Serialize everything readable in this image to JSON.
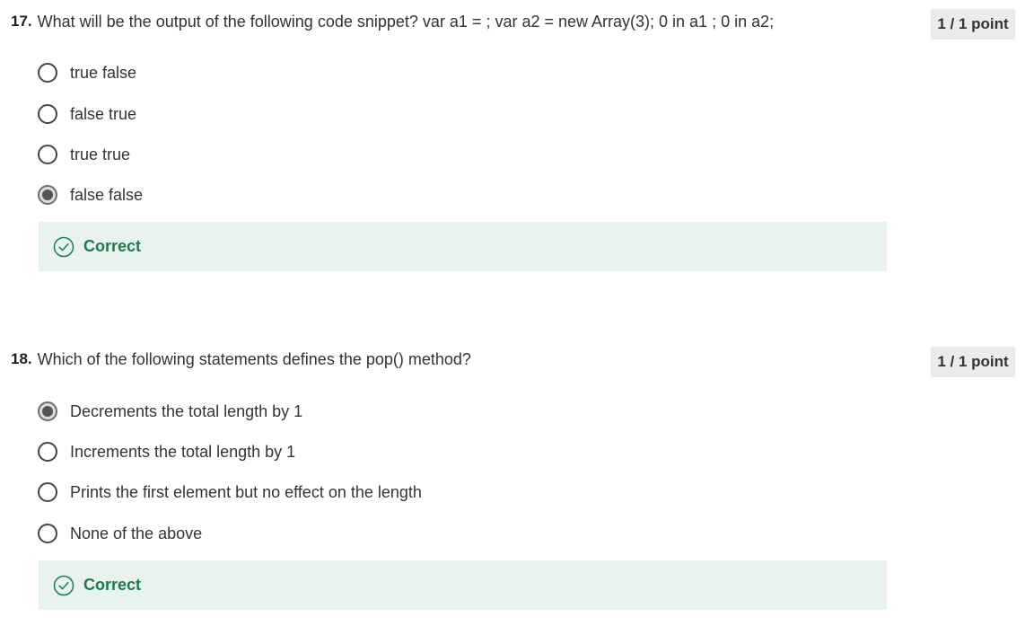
{
  "colors": {
    "correct_bg": "#e8f2ee",
    "correct_text": "#1e7a4f",
    "points_bg": "#ebebeb"
  },
  "questions": [
    {
      "number": "17.",
      "text": "What will be the output of the following code snippet? var a1 = ; var a2 = new Array(3); 0 in a1 ; 0 in a2;",
      "points": "1 / 1 point",
      "options": [
        {
          "label": "true false",
          "selected": false
        },
        {
          "label": "false true",
          "selected": false
        },
        {
          "label": "true true",
          "selected": false
        },
        {
          "label": "false false",
          "selected": true
        }
      ],
      "feedback": {
        "icon": "check-circle-icon",
        "label": "Correct"
      }
    },
    {
      "number": "18.",
      "text": "Which of the following statements defines the pop() method?",
      "points": "1 / 1 point",
      "options": [
        {
          "label": "Decrements the total length by 1",
          "selected": true
        },
        {
          "label": "Increments the total length by 1",
          "selected": false
        },
        {
          "label": "Prints the first element but no effect on the length",
          "selected": false
        },
        {
          "label": "None of the above",
          "selected": false
        }
      ],
      "feedback": {
        "icon": "check-circle-icon",
        "label": "Correct"
      }
    }
  ]
}
